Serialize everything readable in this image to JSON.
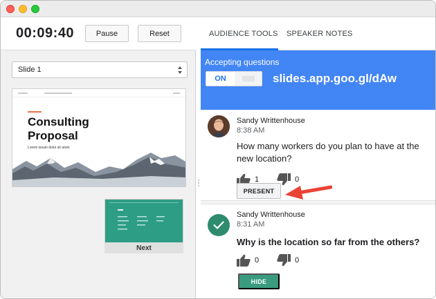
{
  "timer": {
    "elapsed": "00:09:40",
    "pause_label": "Pause",
    "reset_label": "Reset"
  },
  "slide_select": {
    "selected": "Slide 1"
  },
  "current_slide": {
    "title": "Consulting Proposal",
    "subtitle": "Lorem ipsum dolor sit amet."
  },
  "next_slide": {
    "label": "Next"
  },
  "tabs": [
    {
      "label": "AUDIENCE TOOLS",
      "active": true
    },
    {
      "label": "SPEAKER NOTES",
      "active": false
    }
  ],
  "qa": {
    "status_label": "Accepting questions",
    "toggle_on_label": "ON",
    "url": "slides.app.goo.gl/dAw"
  },
  "questions": [
    {
      "author": "Sandy Writtenhouse",
      "time": "8:38 AM",
      "text": "How many workers do you plan to have at the new location?",
      "upvotes": "1",
      "downvotes": "0",
      "action_label": "PRESENT"
    },
    {
      "author": "Sandy Writtenhouse",
      "time": "8:31 AM",
      "text": "Why is the location so far from the others?",
      "upvotes": "0",
      "downvotes": "0",
      "action_label": "HIDE"
    }
  ],
  "colors": {
    "banner": "#4285f4",
    "active_tab": "#1a73e8",
    "hide_button": "#3b9b7f",
    "arrow": "#ea4335",
    "next_slide_bg": "#2e9d86"
  }
}
